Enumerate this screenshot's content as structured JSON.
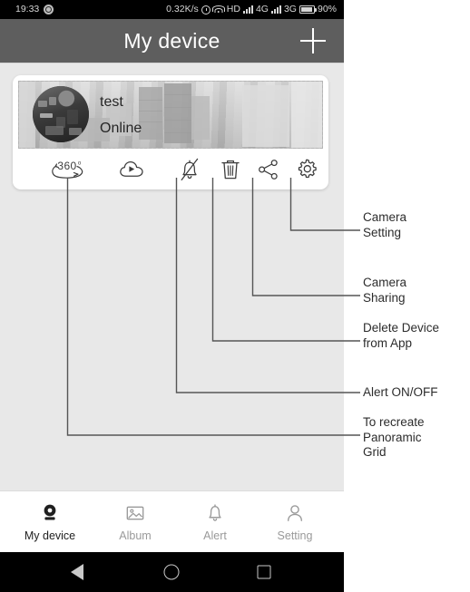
{
  "statusbar": {
    "time": "19:33",
    "app_icon": "whatsapp-icon",
    "net_speed": "0.32K/s",
    "alarm_icon": "alarm-clock-icon",
    "wifi_icon": "wifi-icon",
    "hd_label": "HD",
    "sim1_label": "4G",
    "sim2_label": "3G",
    "battery_icon": "battery-icon",
    "battery_pct": "90%"
  },
  "appbar": {
    "title": "My device",
    "add_icon": "plus-icon"
  },
  "card": {
    "device_name": "test",
    "device_status": "Online",
    "avatar": "camera-snapshot-avatar",
    "thumbnail": "camera-preview-thumbnail",
    "actions": [
      {
        "id": "panorama",
        "icon": "360-panorama-icon",
        "label": "360"
      },
      {
        "id": "cloud",
        "icon": "cloud-playback-icon",
        "label": ""
      },
      {
        "id": "alert",
        "icon": "bell-off-icon",
        "label": ""
      },
      {
        "id": "delete",
        "icon": "trash-icon",
        "label": ""
      },
      {
        "id": "share",
        "icon": "share-icon",
        "label": ""
      },
      {
        "id": "settings",
        "icon": "gear-icon",
        "label": ""
      }
    ]
  },
  "annotations": [
    {
      "id": "camera-setting",
      "text": "Camera\nSetting",
      "line1": "Camera",
      "line2": "Setting",
      "line3": ""
    },
    {
      "id": "camera-sharing",
      "text": "Camera\nSharing",
      "line1": "Camera",
      "line2": "Sharing",
      "line3": ""
    },
    {
      "id": "delete-device",
      "text": "Delete Device\nfrom App",
      "line1": "Delete Device",
      "line2": "from App",
      "line3": ""
    },
    {
      "id": "alert-onoff",
      "text": "Alert ON/OFF",
      "line1": "Alert ON/OFF",
      "line2": "",
      "line3": ""
    },
    {
      "id": "panoramic-grid",
      "text": "To recreate\nPanoramic\nGrid",
      "line1": "To recreate",
      "line2": "Panoramic",
      "line3": "Grid"
    }
  ],
  "tabbar": {
    "items": [
      {
        "id": "my-device",
        "label": "My device",
        "icon": "camera-icon",
        "active": true
      },
      {
        "id": "album",
        "label": "Album",
        "icon": "photo-icon",
        "active": false
      },
      {
        "id": "alert",
        "label": "Alert",
        "icon": "bell-icon",
        "active": false
      },
      {
        "id": "setting",
        "label": "Setting",
        "icon": "person-icon",
        "active": false
      }
    ]
  },
  "navbar": {
    "back_icon": "back-triangle-icon",
    "home_icon": "home-circle-icon",
    "recents_icon": "recents-square-icon"
  },
  "colors": {
    "appbar": "#5e5e5e",
    "page_bg": "#e8e8e8",
    "card_bg": "#ffffff",
    "active_tab": "#1f1f1f",
    "inactive_tab": "#9a9a9a",
    "leader_line": "#555555"
  }
}
